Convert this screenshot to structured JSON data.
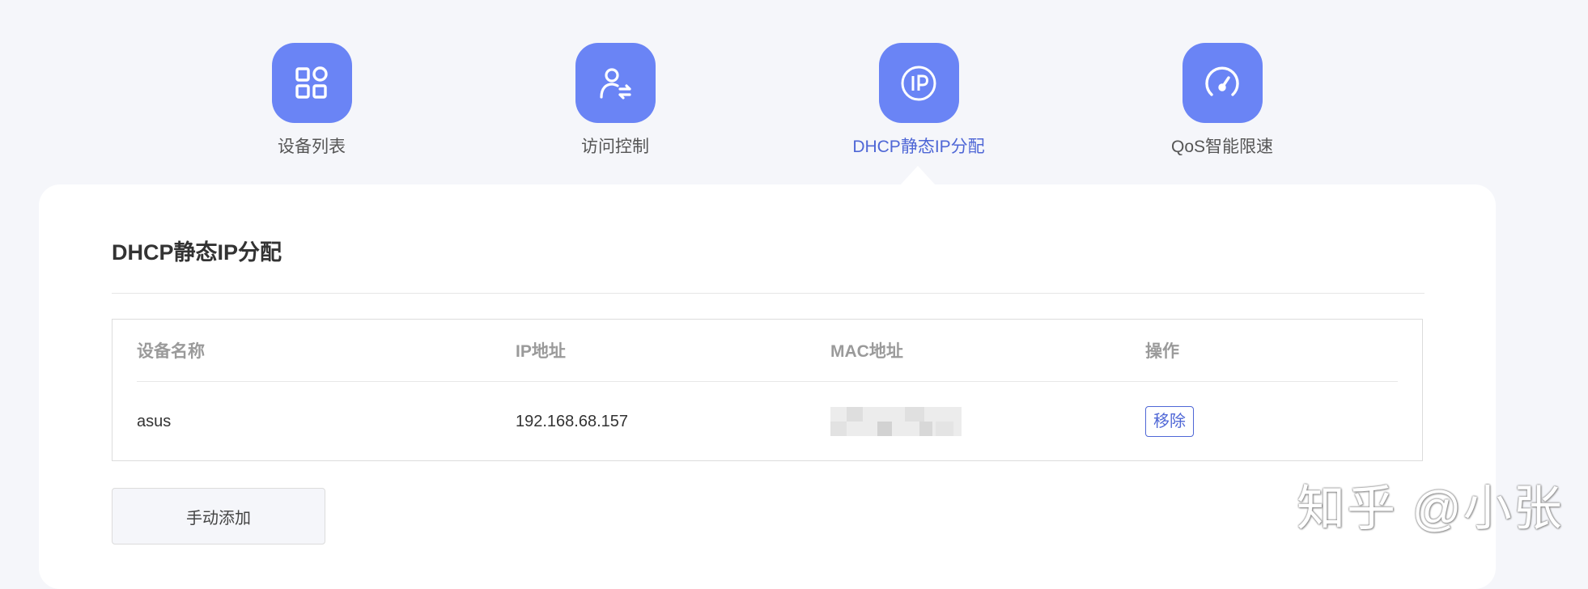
{
  "tabs": [
    {
      "label": "设备列表",
      "icon": "grid-icon",
      "active": false
    },
    {
      "label": "访问控制",
      "icon": "user-swap-icon",
      "active": false
    },
    {
      "label": "DHCP静态IP分配",
      "icon": "ip-icon",
      "active": true
    },
    {
      "label": "QoS智能限速",
      "icon": "speedometer-icon",
      "active": false
    }
  ],
  "section": {
    "title": "DHCP静态IP分配"
  },
  "table": {
    "headers": [
      "设备名称",
      "IP地址",
      "MAC地址",
      "操作"
    ],
    "rows": [
      {
        "name": "asus",
        "ip": "192.168.68.157",
        "mac": "",
        "action": "移除"
      }
    ]
  },
  "add_button": "手动添加",
  "watermark": "知乎 @小张",
  "colors": {
    "accent": "#6a84f5",
    "active_text": "#4f67d6",
    "background": "#f5f6fa"
  }
}
